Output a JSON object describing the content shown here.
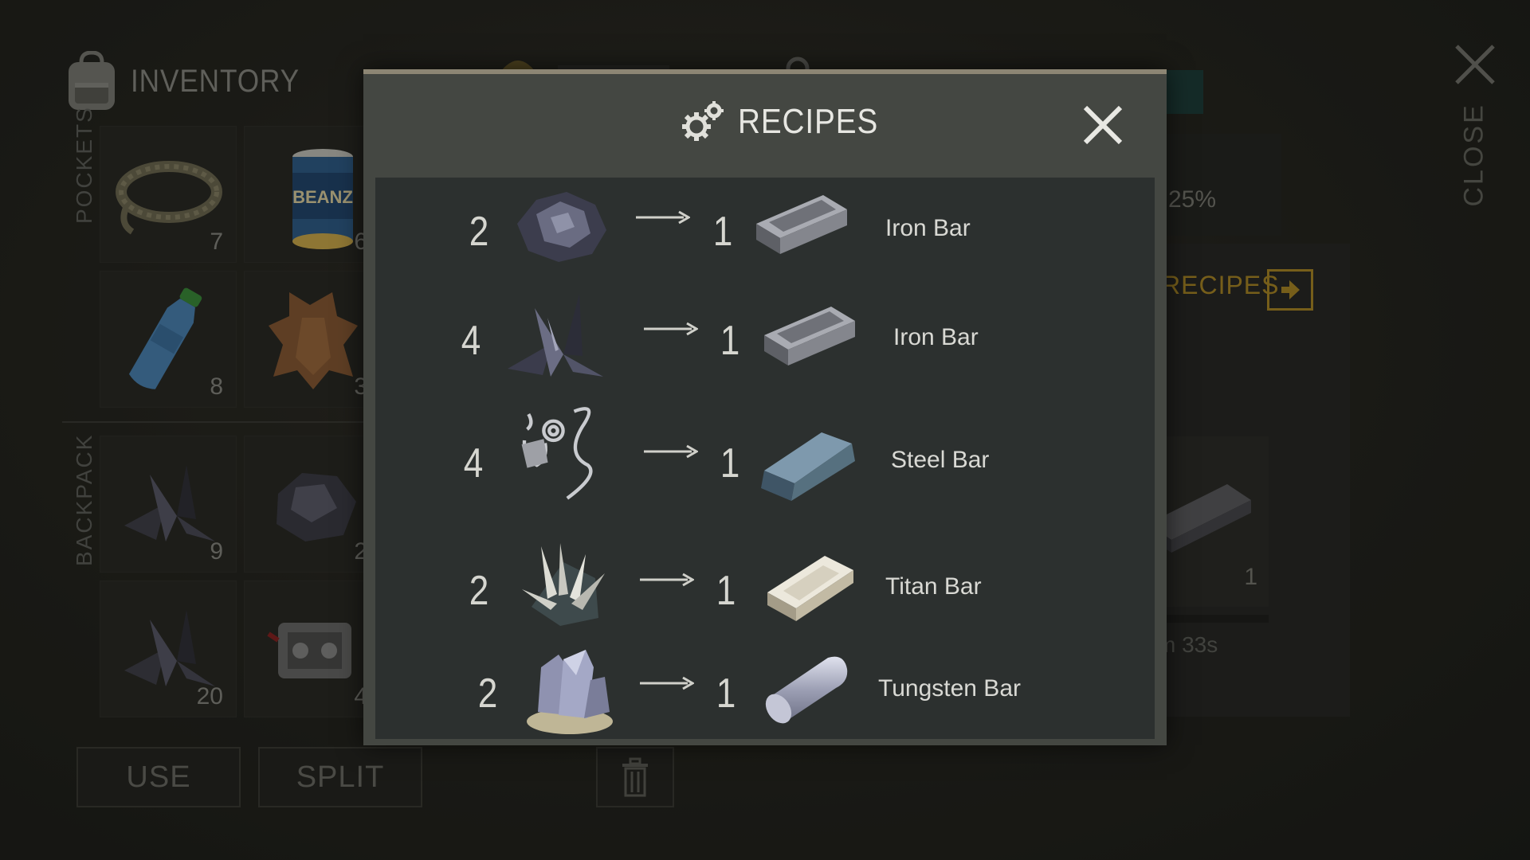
{
  "inventory": {
    "title": "INVENTORY",
    "pockets_label": "POCKETS",
    "backpack_label": "BACKPACK",
    "pocket_slots": [
      {
        "icon": "rope-icon",
        "count": "7"
      },
      {
        "icon": "canned-beans-icon",
        "count": "6"
      },
      {
        "icon": "water-bottle-icon",
        "count": "8"
      },
      {
        "icon": "animal-hide-icon",
        "count": "3"
      }
    ],
    "backpack_slots": [
      {
        "icon": "metal-scrap-icon",
        "count": "9"
      },
      {
        "icon": "iron-ore-icon",
        "count": "2"
      },
      {
        "icon": "metal-scrap-icon",
        "count": "20"
      },
      {
        "icon": "engine-part-icon",
        "count": "4"
      }
    ],
    "use_label": "USE",
    "split_label": "SPLIT"
  },
  "side": {
    "close_label": "CLOSE",
    "percent_text": "25%",
    "recipes_link": "RECIPES",
    "output_count": "1",
    "timer_text": "m 33s"
  },
  "modal": {
    "title": "RECIPES",
    "recipes": [
      {
        "in_qty": "2",
        "in_icon": "iron-ore-icon",
        "out_qty": "1",
        "out_icon": "iron-bar-icon",
        "name": "Iron Bar"
      },
      {
        "in_qty": "4",
        "in_icon": "metal-scrap-icon",
        "out_qty": "1",
        "out_icon": "iron-bar-icon",
        "name": "Iron Bar"
      },
      {
        "in_qty": "4",
        "in_icon": "metal-shavings-icon",
        "out_qty": "1",
        "out_icon": "steel-bar-icon",
        "name": "Steel Bar"
      },
      {
        "in_qty": "2",
        "in_icon": "titan-ore-icon",
        "out_qty": "1",
        "out_icon": "titan-bar-icon",
        "name": "Titan Bar"
      },
      {
        "in_qty": "2",
        "in_icon": "tungsten-ore-icon",
        "out_qty": "1",
        "out_icon": "tungsten-bar-icon",
        "name": "Tungsten Bar"
      }
    ]
  },
  "colors": {
    "accent_gold": "#b08a24",
    "modal_bg": "#444742",
    "list_bg": "#2c302f",
    "text_light": "#d9d9d4"
  }
}
